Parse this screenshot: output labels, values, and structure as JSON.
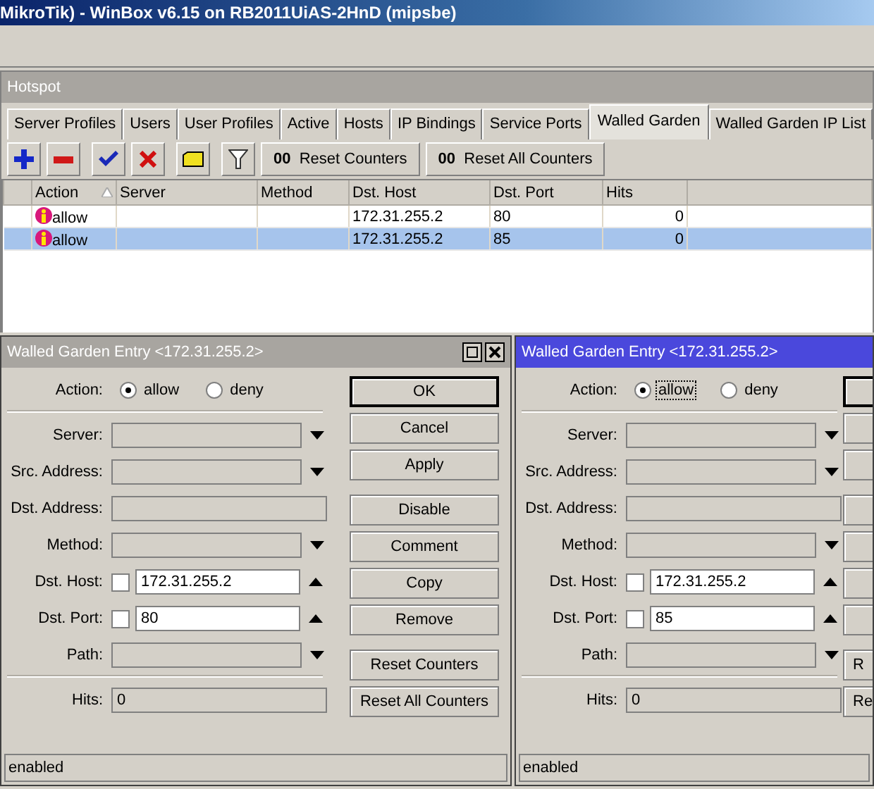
{
  "app_title": "MikroTik) - WinBox v6.15 on RB2011UiAS-2HnD (mipsbe)",
  "hotspot": {
    "title": "Hotspot",
    "tabs": [
      {
        "label": "Server Profiles",
        "selected": false
      },
      {
        "label": "Users",
        "selected": false
      },
      {
        "label": "User Profiles",
        "selected": false
      },
      {
        "label": "Active",
        "selected": false
      },
      {
        "label": "Hosts",
        "selected": false
      },
      {
        "label": "IP Bindings",
        "selected": false
      },
      {
        "label": "Service Ports",
        "selected": false
      },
      {
        "label": "Walled Garden",
        "selected": true
      },
      {
        "label": "Walled Garden IP List",
        "selected": false
      }
    ],
    "toolbar": [
      {
        "kind": "add"
      },
      {
        "kind": "remove"
      },
      {
        "kind": "enable"
      },
      {
        "kind": "disable"
      },
      {
        "kind": "comment"
      },
      {
        "kind": "filter"
      },
      {
        "kind": "text",
        "icon_text": "00",
        "label": "Reset Counters"
      },
      {
        "kind": "text",
        "icon_text": "00",
        "label": "Reset All Counters"
      }
    ],
    "table": {
      "columns": [
        {
          "label": "Action",
          "sorted": true
        },
        {
          "label": "Server",
          "sorted": false
        },
        {
          "label": "Method",
          "sorted": false
        },
        {
          "label": "Dst. Host",
          "sorted": false
        },
        {
          "label": "Dst. Port",
          "sorted": false
        },
        {
          "label": "Hits",
          "sorted": false
        }
      ],
      "rows": [
        {
          "selected": false,
          "cells": [
            "allow",
            "",
            "",
            "172.31.255.2",
            "80",
            "0"
          ]
        },
        {
          "selected": true,
          "cells": [
            "allow",
            "",
            "",
            "172.31.255.2",
            "85",
            "0"
          ]
        }
      ]
    }
  },
  "dialogs": [
    {
      "title": "Walled Garden Entry <172.31.255.2>",
      "active": false,
      "window_buttons": true,
      "action": {
        "label": "Action:",
        "options": [
          {
            "label": "allow",
            "selected": true,
            "focused": false
          },
          {
            "label": "deny",
            "selected": false,
            "focused": false
          }
        ]
      },
      "fields": [
        {
          "kind": "dropdown",
          "label": "Server:"
        },
        {
          "kind": "dropdown",
          "label": "Src. Address:"
        },
        {
          "kind": "plain",
          "label": "Dst. Address:"
        },
        {
          "kind": "dropdown",
          "label": "Method:"
        },
        {
          "kind": "negatable",
          "label": "Dst. Host:",
          "checked": false,
          "value": "172.31.255.2"
        },
        {
          "kind": "negatable",
          "label": "Dst. Port:",
          "checked": false,
          "value": "80"
        },
        {
          "kind": "dropdown",
          "label": "Path:"
        }
      ],
      "hits": {
        "label": "Hits:",
        "value": "0"
      },
      "buttons": [
        {
          "label": "OK",
          "default": true
        },
        {
          "label": "Cancel",
          "default": false
        },
        {
          "label": "Apply",
          "default": false
        },
        {
          "label": "Disable",
          "default": false
        },
        {
          "label": "Comment",
          "default": false
        },
        {
          "label": "Copy",
          "default": false
        },
        {
          "label": "Remove",
          "default": false
        },
        {
          "label": "Reset Counters",
          "default": false
        },
        {
          "label": "Reset All Counters",
          "default": false
        }
      ],
      "status": "enabled"
    },
    {
      "title": "Walled Garden Entry <172.31.255.2>",
      "active": true,
      "action": {
        "label": "Action:",
        "options": [
          {
            "label": "allow",
            "selected": true,
            "focused": true
          },
          {
            "label": "deny",
            "selected": false,
            "focused": false
          }
        ]
      },
      "fields": [
        {
          "kind": "dropdown",
          "label": "Server:"
        },
        {
          "kind": "dropdown",
          "label": "Src. Address:"
        },
        {
          "kind": "plain",
          "label": "Dst. Address:"
        },
        {
          "kind": "dropdown",
          "label": "Method:"
        },
        {
          "kind": "negatable",
          "label": "Dst. Host:",
          "checked": false,
          "value": "172.31.255.2"
        },
        {
          "kind": "negatable",
          "label": "Dst. Port:",
          "checked": false,
          "value": "85"
        },
        {
          "kind": "dropdown",
          "label": "Path:"
        }
      ],
      "hits": {
        "label": "Hits:",
        "value": "0"
      },
      "buttons": [
        {
          "default": true
        },
        {
          "default": false
        },
        {
          "default": false
        },
        {
          "default": false
        },
        {
          "default": false
        },
        {
          "default": false
        },
        {
          "default": false
        },
        {
          "label": "R",
          "default": false
        },
        {
          "label": "Re",
          "default": false
        }
      ],
      "status": "enabled"
    }
  ]
}
